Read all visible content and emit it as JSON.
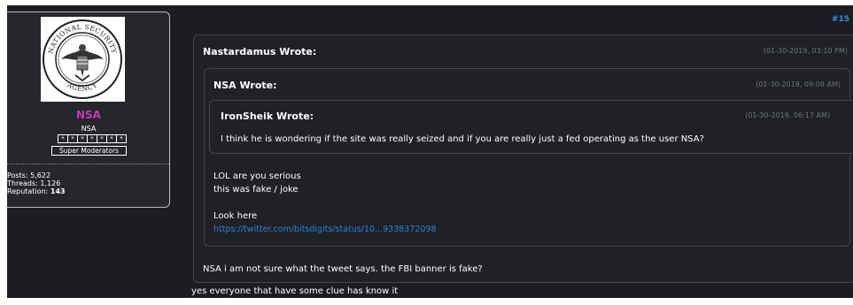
{
  "author": {
    "username": "NSA",
    "user_title": "NSA",
    "stars": [
      "*",
      "*",
      "*",
      "*",
      "*",
      "*",
      "*"
    ],
    "group": "Super Moderators",
    "stats": {
      "posts_label": "Posts:",
      "posts_value": "5,622",
      "threads_label": "Threads:",
      "threads_value": "1,126",
      "reputation_label": "Reputation:",
      "reputation_value": "143"
    }
  },
  "post": {
    "number": "#15",
    "quote_outer": {
      "author": "Nastardamus Wrote:",
      "date": "(01-30-2019, 03:10 PM)",
      "reply": "NSA i am not sure what the tweet says. the FBI banner is fake?"
    },
    "quote_middle": {
      "author": "NSA Wrote:",
      "date": "(01-30-2019, 09:08 AM)",
      "line1": "LOL are you serious",
      "line2": "this was fake / joke",
      "line3": "Look here",
      "link": "https://twitter.com/bitsdigits/status/10...9338372098"
    },
    "quote_inner": {
      "author": "IronSheik Wrote:",
      "date": "(01-30-2019, 06:17 AM)",
      "text": "I think he is wondering if the site was really seized and if you are really just a fed operating as the user NSA?"
    },
    "body": "yes everyone that have some clue has know it"
  },
  "colors": {
    "background": "#1b1d22",
    "username": "#c23bb2",
    "link": "#2f7fd1",
    "post_number": "#2f8fe0"
  }
}
